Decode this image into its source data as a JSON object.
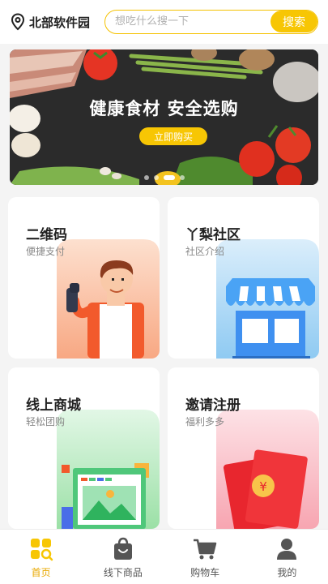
{
  "header": {
    "location": "北部软件园",
    "search_placeholder": "想吃什么搜一下",
    "search_button": "搜索"
  },
  "banner": {
    "title": "健康食材 安全选购",
    "cta": "立即购买",
    "slides": 4,
    "active_slide": 2
  },
  "cards": [
    {
      "title": "二维码",
      "subtitle": "便捷支付"
    },
    {
      "title": "丫梨社区",
      "subtitle": "社区介绍"
    },
    {
      "title": "线上商城",
      "subtitle": "轻松团购"
    },
    {
      "title": "邀请注册",
      "subtitle": "福利多多"
    }
  ],
  "tabbar": [
    {
      "label": "首页",
      "icon": "home-grid-icon",
      "active": true
    },
    {
      "label": "线下商品",
      "icon": "shopping-bag-icon",
      "active": false
    },
    {
      "label": "购物车",
      "icon": "cart-icon",
      "active": false
    },
    {
      "label": "我的",
      "icon": "user-icon",
      "active": false
    }
  ],
  "colors": {
    "accent": "#f7c604",
    "active_tab": "#e8a800"
  }
}
